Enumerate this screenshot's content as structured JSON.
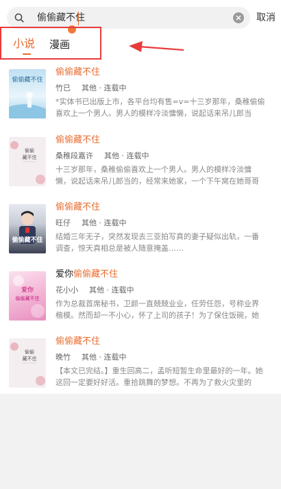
{
  "search": {
    "query": "偷偷藏不住",
    "cancel_label": "取消"
  },
  "tabs": [
    {
      "label": "小说",
      "active": true
    },
    {
      "label": "漫画",
      "active": false
    }
  ],
  "accent": "#e86a2c",
  "results": [
    {
      "title_pre": "",
      "title_hl": "偷偷藏不住",
      "author": "竹已",
      "status": "其他 · 连载中",
      "desc": "*实体书已出版上市，各平台均有售=v=十三岁那年，桑稚偷偷喜欢上一个男人。男人的模样冷淡慵懒，说起话来吊儿郎当的，经常来她家，一个下午窝在她哥哥的房间里打游戏。",
      "cover_text": "偷偷藏不住"
    },
    {
      "title_pre": "",
      "title_hl": "偷偷藏不住",
      "author": "桑稚段嘉许",
      "status": "其他 · 连载中",
      "desc": "十三岁那年，桑稚偷偷喜欢上一个男人。男人的模样冷淡慵懒，说起话来吊儿郎当的，经常来她家，一个下午窝在她哥哥的房间里打游戏。",
      "cover_text": "偷偷藏不住"
    },
    {
      "title_pre": "",
      "title_hl": "偷偷藏不住",
      "author": "旺仔",
      "status": "其他 · 连载中",
      "desc": "结婚三年无子，突然发现去三亚拍写真的妻子疑似出轨，一番调查，惊天真相总是被人随意掩盖……",
      "cover_text": "偷偷藏不住"
    },
    {
      "title_pre": "爱你",
      "title_hl": "偷偷藏不住",
      "author": "花小小",
      "status": "其他 · 连载中",
      "desc": "作为总裁首席秘书，卫颜一直兢兢业业，任劳任怨，号称业界楷模。然而却一不小心，怀了上司的孩子！为了保住饭碗，她决定偷偷生下孩子……",
      "cover_text": "爱你偷偷藏不住"
    },
    {
      "title_pre": "",
      "title_hl": "偷偷藏不住",
      "author": "晚竹",
      "status": "其他 · 连载中",
      "desc": "【本文已完结。】重生回高二，孟听短暂生命里最好的一年。她这回一定要好好活。重拾跳舞的梦想。不再为了救火灾里的人……",
      "cover_text": "偷偷藏不住"
    }
  ]
}
